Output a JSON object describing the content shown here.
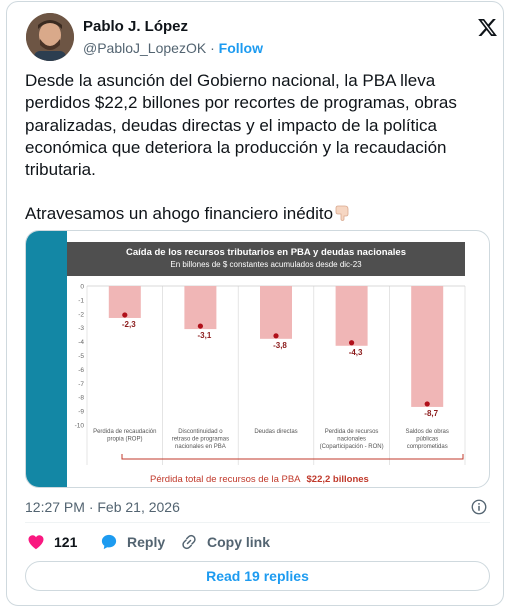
{
  "author": {
    "name": "Pablo J. López",
    "handle": "@PabloJ_LopezOK",
    "follow_label": "Follow"
  },
  "tweet": {
    "paragraph1": "Desde la asunción del Gobierno nacional, la PBA lleva perdidos $22,2 billones por recortes de programas, obras paralizadas, deudas directas y el impacto de la política económica que deteriora la producción y la recaudación tributaria.",
    "paragraph2": "Atravesamos un ahogo financiero inédito",
    "paragraph2_emoji": "pointing-down-hand-icon"
  },
  "chart_data": {
    "type": "bar",
    "title": "Caída de los recursos tributarios en PBA y deudas nacionales",
    "subtitle": "En billones de $ constantes acumulados desde dic-23",
    "categories": [
      "Perdida de recaudación propia (ROP)",
      "Discontinuidad o retraso de programas nacionales en PBA",
      "Deudas directas",
      "Perdida de recursos nacionales (Coparticipación - RON)",
      "Saldos de obras públicas comprometidas"
    ],
    "category_lines": [
      [
        "Perdida de recaudación",
        "propia (ROP)"
      ],
      [
        "Discontinuidad o",
        "retraso de programas",
        "nacionales en PBA"
      ],
      [
        "Deudas directas"
      ],
      [
        "Perdida de recursos",
        "nacionales",
        "(Coparticipación - RON)"
      ],
      [
        "Saldos de obras",
        "públicas",
        "comprometidas"
      ]
    ],
    "values": [
      -2.3,
      -3.1,
      -3.8,
      -4.3,
      -8.7
    ],
    "data_labels": [
      "-2,3",
      "-3,1",
      "-3,8",
      "-4,3",
      "-8,7"
    ],
    "y_ticks": [
      "0",
      "-1",
      "-2",
      "-3",
      "-4",
      "-5",
      "-6",
      "-7",
      "-8",
      "-9",
      "-10"
    ],
    "ylim": [
      -10,
      0
    ],
    "total_label": "Pérdida total de recursos de la PBA",
    "total_value": "$22,2 billones",
    "bar_color": "#f0b6b6",
    "dot_color": "#b0101a",
    "label_color": "#c0392b"
  },
  "meta": {
    "timestamp": "12:27 PM · Feb 21, 2026"
  },
  "actions": {
    "likes_count": "121",
    "reply_label": "Reply",
    "copy_label": "Copy link"
  },
  "read_replies_label": "Read 19 replies"
}
